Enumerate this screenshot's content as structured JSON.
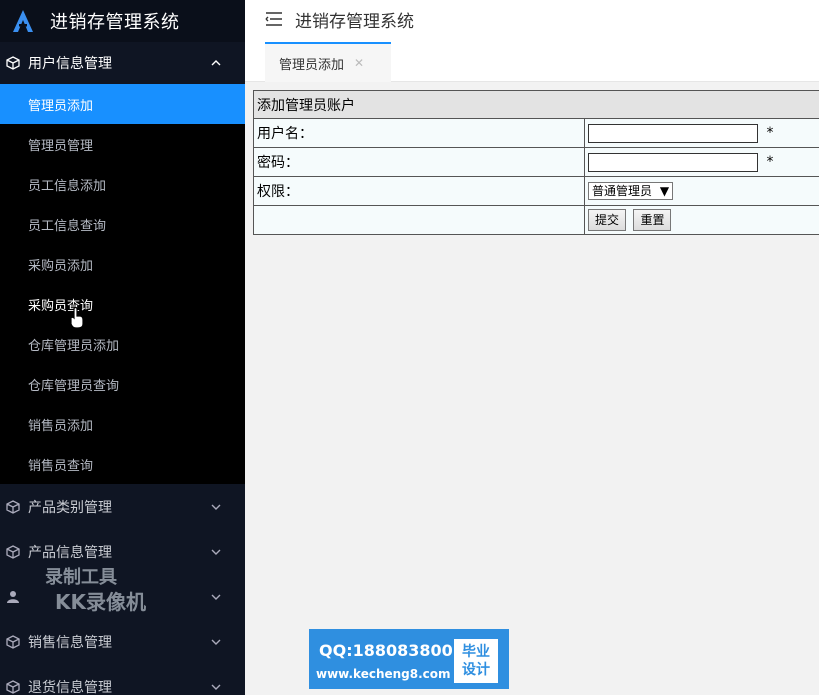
{
  "app": {
    "title": "进销存管理系统"
  },
  "sidebar": {
    "groups": [
      {
        "label": "用户信息管理",
        "items": [
          "管理员添加",
          "管理员管理",
          "员工信息添加",
          "员工信息查询",
          "采购员添加",
          "采购员查询",
          "仓库管理员添加",
          "仓库管理员查询",
          "销售员添加",
          "销售员查询"
        ]
      },
      {
        "label": "产品类别管理"
      },
      {
        "label": "产品信息管理"
      },
      {
        "label": "销售信息管理"
      },
      {
        "label": "退货信息管理"
      }
    ]
  },
  "tabs": [
    {
      "label": "管理员添加"
    }
  ],
  "form": {
    "title": "添加管理员账户",
    "username_label": "用户名：",
    "password_label": "密码：",
    "role_label": "权限：",
    "required_mark": "*",
    "role_selected": "普通管理员",
    "submit_label": "提交",
    "reset_label": "重置"
  },
  "watermark": {
    "line1": "录制工具",
    "line2": "KK录像机",
    "qq": "QQ:188083800",
    "url": "www.kecheng8.com",
    "badge_line1": "毕业",
    "badge_line2": "设计"
  },
  "colors": {
    "sidebar_bg": "#0f1523",
    "accent": "#1890ff",
    "watermark_blue": "#2f8fe0"
  }
}
